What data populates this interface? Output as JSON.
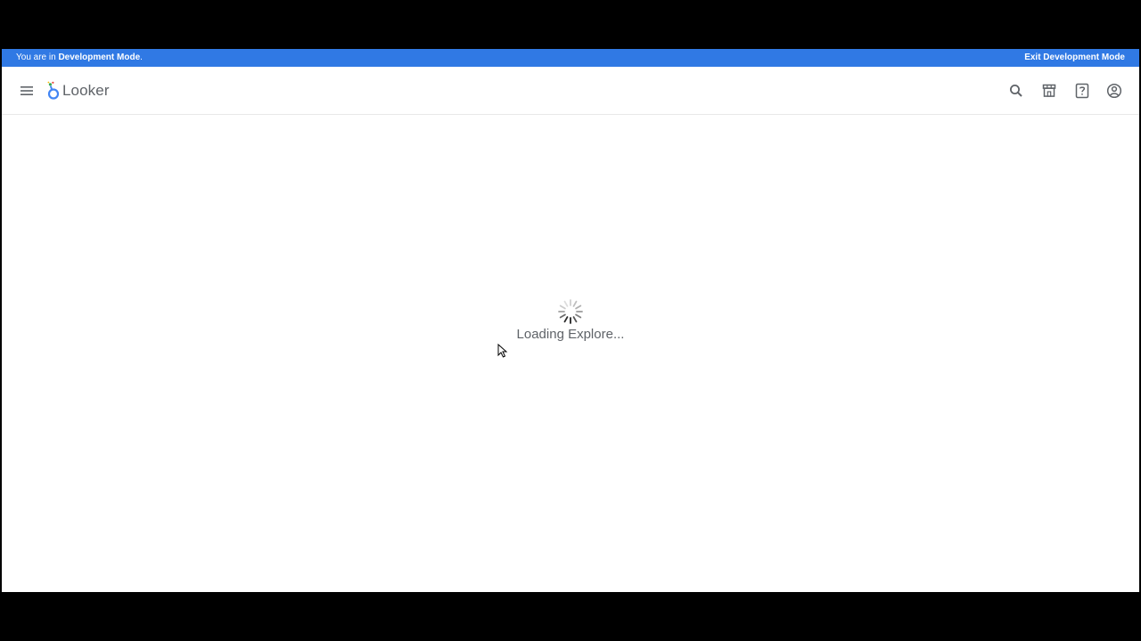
{
  "banner": {
    "prefix": "You are in ",
    "mode": "Development Mode",
    "suffix": ".",
    "exit_label": "Exit Development Mode",
    "color": "#3079e4"
  },
  "header": {
    "menu_icon": "hamburger-menu-icon",
    "logo_text": "Looker",
    "icons": [
      "search-icon",
      "marketplace-icon",
      "help-icon",
      "account-icon"
    ]
  },
  "main": {
    "loading_text": "Loading Explore..."
  }
}
